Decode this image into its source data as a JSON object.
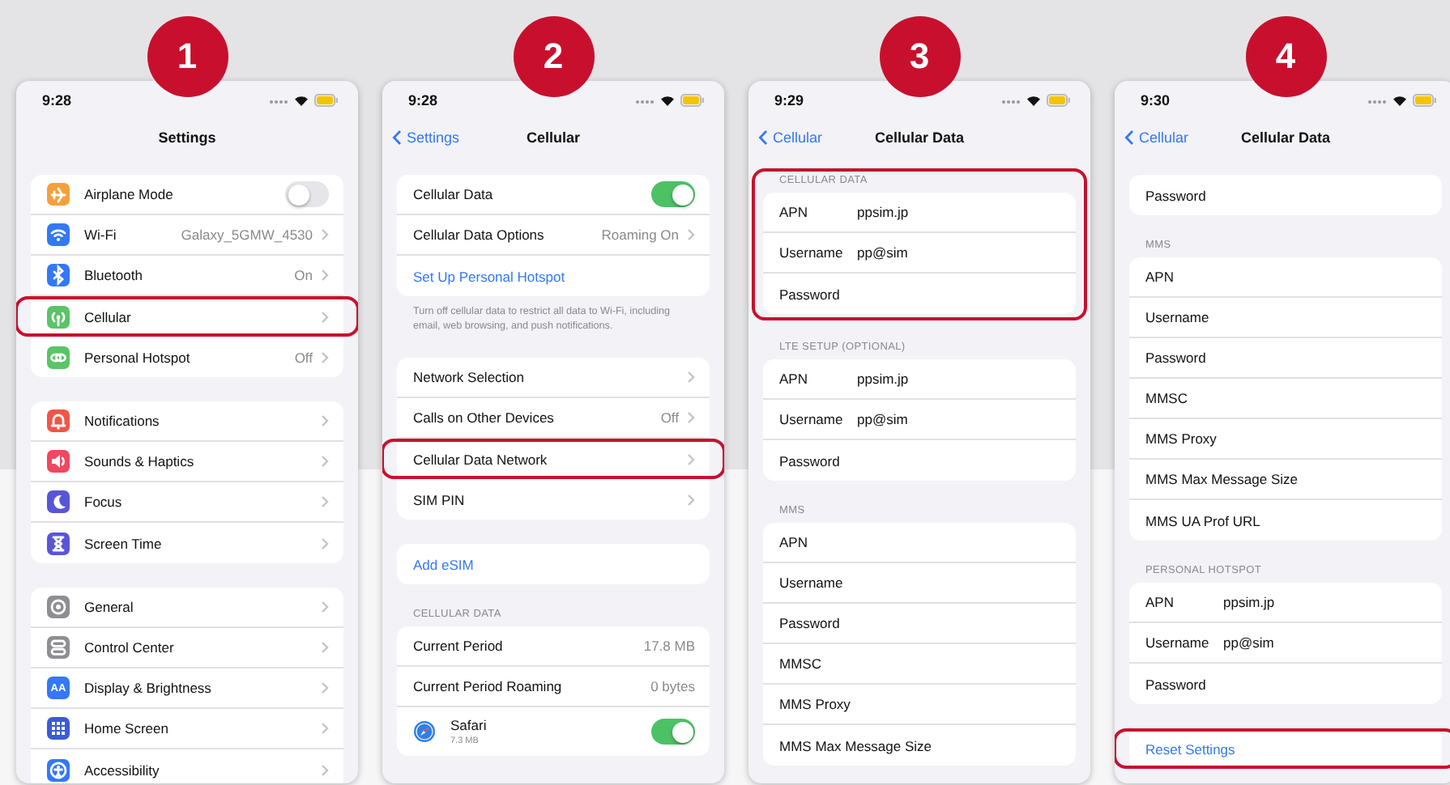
{
  "panels": [
    {
      "step": "1",
      "time": "9:28",
      "nav": {
        "title": "Settings"
      },
      "sections": [
        {
          "rows": [
            {
              "kind": "toggle",
              "label": "Airplane Mode",
              "on": false,
              "color": "#f5a03c"
            },
            {
              "kind": "nav",
              "label": "Wi-Fi",
              "value": "Galaxy_5GMW_4530",
              "color": "#3478f6"
            },
            {
              "kind": "nav",
              "label": "Bluetooth",
              "value": "On",
              "color": "#3478f6"
            },
            {
              "kind": "nav",
              "label": "Cellular",
              "color": "#5ac466",
              "highlighted": true
            },
            {
              "kind": "nav",
              "label": "Personal Hotspot",
              "value": "Off",
              "color": "#5ac466"
            }
          ]
        },
        {
          "rows": [
            {
              "kind": "nav",
              "label": "Notifications",
              "color": "#f05548"
            },
            {
              "kind": "nav",
              "label": "Sounds & Haptics",
              "color": "#f0485f"
            },
            {
              "kind": "nav",
              "label": "Focus",
              "color": "#5856d6"
            },
            {
              "kind": "nav",
              "label": "Screen Time",
              "color": "#5856d6"
            }
          ]
        },
        {
          "rows": [
            {
              "kind": "nav",
              "label": "General",
              "color": "#8e8e93"
            },
            {
              "kind": "nav",
              "label": "Control Center",
              "color": "#8e8e93"
            },
            {
              "kind": "nav",
              "label": "Display & Brightness",
              "color": "#3478f6",
              "icon_text": "AA"
            },
            {
              "kind": "nav",
              "label": "Home Screen",
              "color": "#3b5bd6"
            },
            {
              "kind": "nav",
              "label": "Accessibility",
              "color": "#3478f6"
            }
          ]
        }
      ]
    },
    {
      "step": "2",
      "time": "9:28",
      "nav": {
        "back": "Settings",
        "title": "Cellular"
      },
      "sections": [
        {
          "rows": [
            {
              "kind": "toggle",
              "label": "Cellular Data",
              "on": true
            },
            {
              "kind": "nav",
              "label": "Cellular Data Options",
              "value": "Roaming On"
            },
            {
              "kind": "link",
              "label": "Set Up Personal Hotspot"
            }
          ],
          "footer": "Turn off cellular data to restrict all data to Wi-Fi, including email, web browsing, and push notifications."
        },
        {
          "rows": [
            {
              "kind": "nav",
              "label": "Network Selection"
            },
            {
              "kind": "nav",
              "label": "Calls on Other Devices",
              "value": "Off"
            },
            {
              "kind": "nav",
              "label": "Cellular Data Network",
              "highlighted": true
            },
            {
              "kind": "nav",
              "label": "SIM PIN"
            }
          ]
        },
        {
          "rows": [
            {
              "kind": "link",
              "label": "Add eSIM"
            }
          ]
        },
        {
          "header": "CELLULAR DATA",
          "rows": [
            {
              "kind": "stat",
              "label": "Current Period",
              "value": "17.8 MB"
            },
            {
              "kind": "stat",
              "label": "Current Period Roaming",
              "value": "0 bytes"
            },
            {
              "kind": "app",
              "label": "Safari",
              "value": "7.3 MB",
              "on": true
            }
          ]
        }
      ]
    },
    {
      "step": "3",
      "time": "9:29",
      "nav": {
        "back": "Cellular",
        "title": "Cellular Data"
      },
      "sections": [
        {
          "header": "CELLULAR DATA",
          "highlighted": true,
          "rows": [
            {
              "kind": "field",
              "label": "APN",
              "value": "ppsim.jp"
            },
            {
              "kind": "field",
              "label": "Username",
              "value": "pp@sim"
            },
            {
              "kind": "field",
              "label": "Password"
            }
          ]
        },
        {
          "header": "LTE SETUP (OPTIONAL)",
          "rows": [
            {
              "kind": "field",
              "label": "APN",
              "value": "ppsim.jp"
            },
            {
              "kind": "field",
              "label": "Username",
              "value": "pp@sim"
            },
            {
              "kind": "field",
              "label": "Password"
            }
          ]
        },
        {
          "header": "MMS",
          "rows": [
            {
              "kind": "field",
              "label": "APN"
            },
            {
              "kind": "field",
              "label": "Username"
            },
            {
              "kind": "field",
              "label": "Password"
            },
            {
              "kind": "field",
              "label": "MMSC"
            },
            {
              "kind": "field",
              "label": "MMS Proxy"
            },
            {
              "kind": "field",
              "label": "MMS Max Message Size"
            }
          ]
        }
      ]
    },
    {
      "step": "4",
      "time": "9:30",
      "nav": {
        "back": "Cellular",
        "title": "Cellular Data"
      },
      "sections": [
        {
          "rows": [
            {
              "kind": "field",
              "label": "Password"
            }
          ]
        },
        {
          "header": "MMS",
          "rows": [
            {
              "kind": "field",
              "label": "APN"
            },
            {
              "kind": "field",
              "label": "Username"
            },
            {
              "kind": "field",
              "label": "Password"
            },
            {
              "kind": "field",
              "label": "MMSC"
            },
            {
              "kind": "field",
              "label": "MMS Proxy"
            },
            {
              "kind": "field",
              "label": "MMS Max Message Size"
            },
            {
              "kind": "field",
              "label": "MMS UA Prof URL"
            }
          ]
        },
        {
          "header": "PERSONAL HOTSPOT",
          "rows": [
            {
              "kind": "field",
              "label": "APN",
              "value": "ppsim.jp"
            },
            {
              "kind": "field",
              "label": "Username",
              "value": "pp@sim"
            },
            {
              "kind": "field",
              "label": "Password"
            }
          ]
        },
        {
          "rows": [
            {
              "kind": "link",
              "label": "Reset Settings",
              "highlighted": true
            }
          ]
        }
      ]
    }
  ]
}
